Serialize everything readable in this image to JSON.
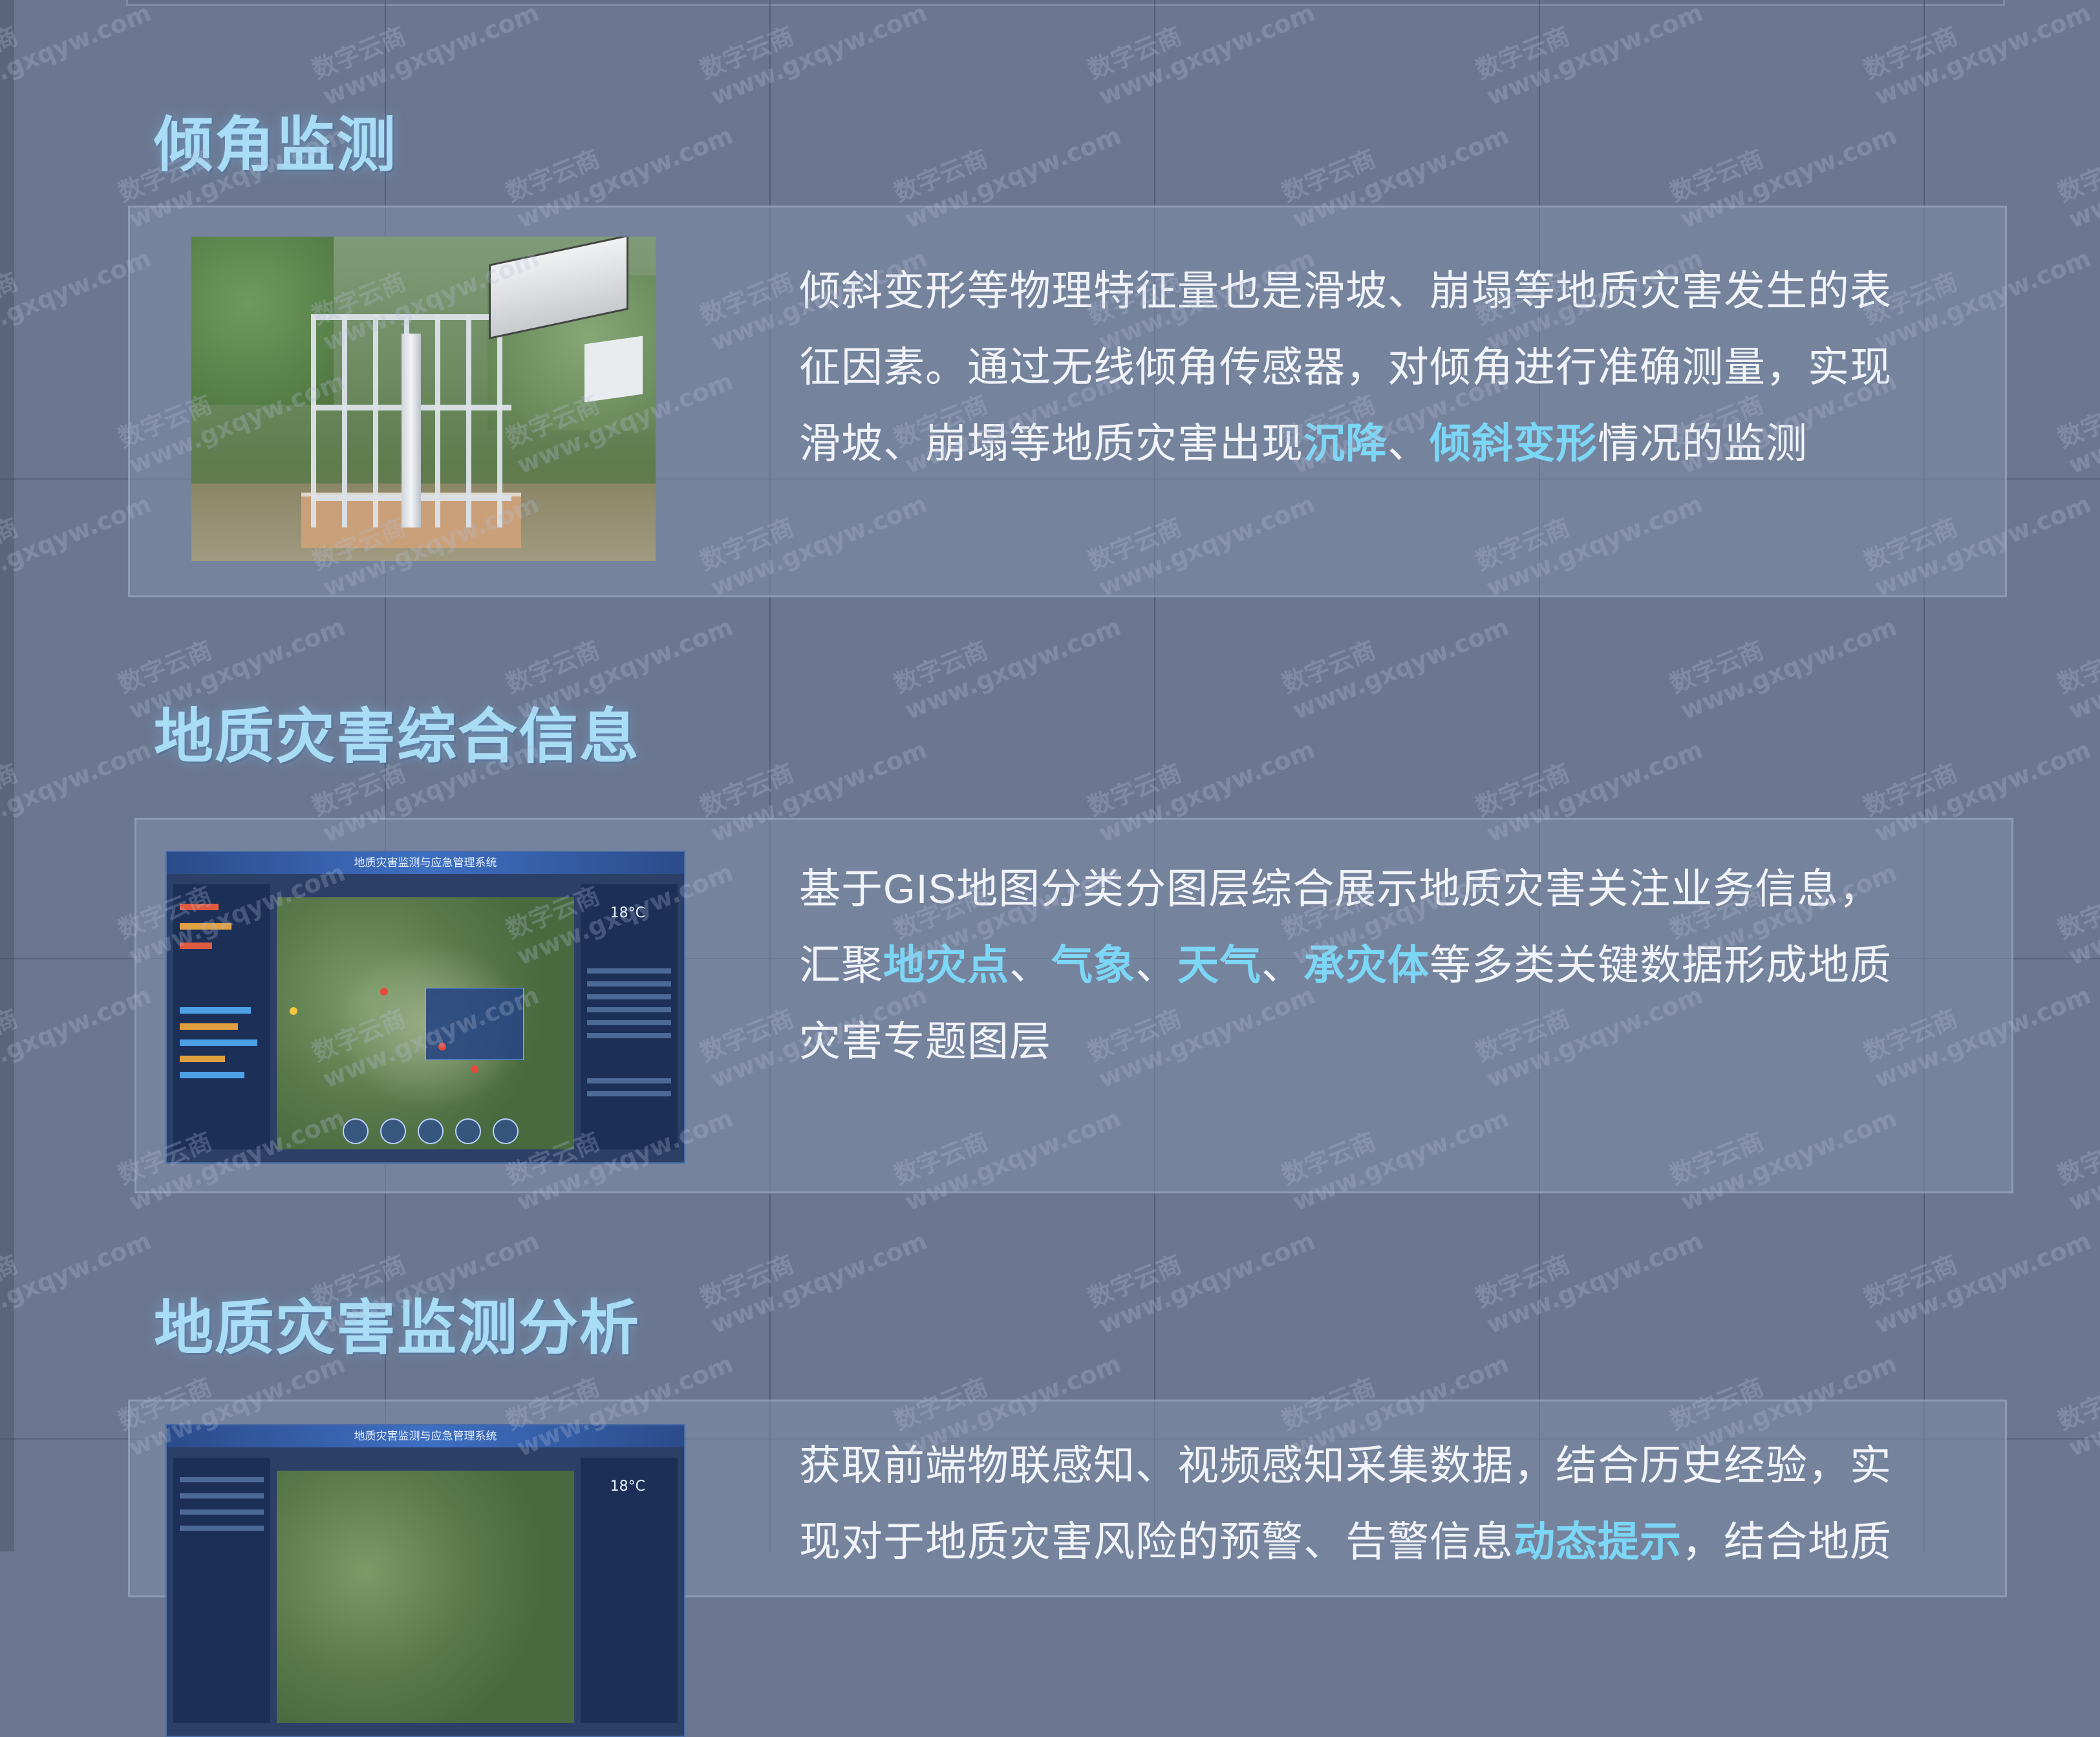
{
  "sections": [
    {
      "title": "倾角监测",
      "text_parts": [
        {
          "t": "倾斜变形等物理特征量也是滑坡、崩塌等地质灾害发生的表征因素。通过无线倾角传感器，对倾角进行准确测量，实现滑坡、崩塌等地质灾害出现",
          "hl": false
        },
        {
          "t": "沉降",
          "hl": true
        },
        {
          "t": "、",
          "hl": false
        },
        {
          "t": "倾斜变形",
          "hl": true
        },
        {
          "t": "情况的监测",
          "hl": false
        }
      ]
    },
    {
      "title": "地质灾害综合信息",
      "dashboard_title": "地质灾害监测与应急管理系统",
      "dashboard_temp": "18°C",
      "text_parts": [
        {
          "t": "基于GIS地图分类分图层综合展示地质灾害关注业务信息，汇聚",
          "hl": false
        },
        {
          "t": "地灾点",
          "hl": true
        },
        {
          "t": "、",
          "hl": false
        },
        {
          "t": "气象",
          "hl": true
        },
        {
          "t": "、",
          "hl": false
        },
        {
          "t": "天气",
          "hl": true
        },
        {
          "t": "、",
          "hl": false
        },
        {
          "t": "承灾体",
          "hl": true
        },
        {
          "t": "等多类关键数据形成地质灾害专题图层",
          "hl": false
        }
      ]
    },
    {
      "title": "地质灾害监测分析",
      "dashboard_title": "地质灾害监测与应急管理系统",
      "dashboard_temp": "18°C",
      "text_parts": [
        {
          "t": "获取前端物联感知、视频感知采集数据，结合历史经验，实现对于地质灾害风险的预警、告警信息",
          "hl": false
        },
        {
          "t": "动态提示",
          "hl": true
        },
        {
          "t": "，结合地质",
          "hl": false
        }
      ]
    }
  ],
  "watermark": {
    "brand": "数字云商",
    "url": "www.gxqyw.com"
  }
}
